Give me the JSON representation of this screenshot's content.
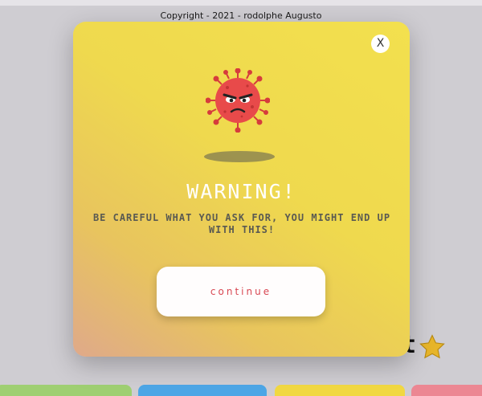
{
  "footer": {
    "copyright": "Copyright - 2021 - rodolphe Augusto"
  },
  "background": {
    "heading_fragment": "t"
  },
  "modal": {
    "close_label": "X",
    "title": "WARNING!",
    "message": "BE CAREFUL WHAT YOU ASK FOR, YOU MIGHT END UP WITH THIS!",
    "continue_label": "continue",
    "icon": "angry-virus-icon"
  },
  "colors": {
    "modal_gradient_top": "#f3e04e",
    "modal_gradient_bottom": "#dfa98a",
    "virus": "#e84a4a",
    "button_text": "#d84752",
    "star": "#e7b52a"
  }
}
